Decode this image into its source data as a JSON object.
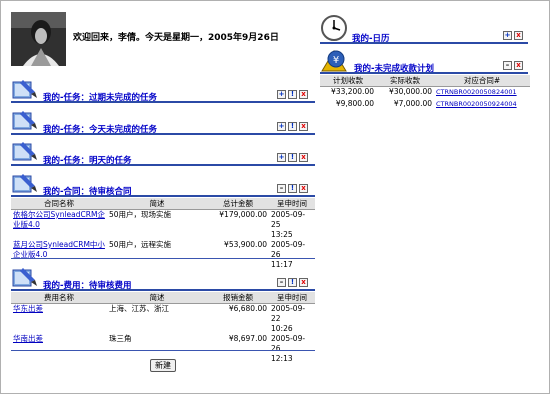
{
  "welcome_text": "欢迎回来，李倩。今天是星期一，2005年9月26日",
  "left_panels": {
    "overdue_tasks": "我的-任务：过期未完成的任务",
    "today_tasks": "我的-任务：今天未完成的任务",
    "tomorrow_tasks": "我的-任务：明天的任务",
    "contracts": "我的-合同：待审核合同",
    "expenses": "我的-费用：待审核费用"
  },
  "contracts_table": {
    "headers": [
      "合同名称",
      "简述",
      "总计金额",
      "呈申时间"
    ],
    "rows": [
      {
        "name_l1": "依格尔公司SynleadCRM企",
        "name_l2": "业版4.0",
        "desc": "50用户，现场实施",
        "amount": "¥179,000.00",
        "date": "2005-09-25",
        "time": "13:25"
      },
      {
        "name_l1": "蓝月公司SynleadCRM中小",
        "name_l2": "企业版4.0",
        "desc": "50用户，远程实施",
        "amount": "¥53,900.00",
        "date": "2005-09-26",
        "time": "11:17"
      }
    ]
  },
  "expenses_table": {
    "headers": [
      "费用名称",
      "简述",
      "报销金额",
      "呈申时间"
    ],
    "rows": [
      {
        "name": "华东出差",
        "desc": "上海、江苏、浙江",
        "amount": "¥6,680.00",
        "date": "2005-09-22",
        "time": "10:26"
      },
      {
        "name": "华南出差",
        "desc": "珠三角",
        "amount": "¥8,697.00",
        "date": "2005-09-26",
        "time": "12:13"
      }
    ]
  },
  "new_button": "新建",
  "right_panels": {
    "calendar": "我的-日历",
    "receivables": "我的-未完成收款计划"
  },
  "receivables_table": {
    "headers": [
      "计划收款",
      "实际收款",
      "对应合同#"
    ],
    "rows": [
      {
        "planned": "¥33,200.00",
        "actual": "¥30,000.00",
        "contract": "CTRNBR0020050824001"
      },
      {
        "planned": "¥9,800.00",
        "actual": "¥7,000.00",
        "contract": "CTRNBR0020050924004"
      }
    ]
  },
  "buttons": {
    "min": "–",
    "info": "!",
    "close": "x",
    "add": "+"
  }
}
